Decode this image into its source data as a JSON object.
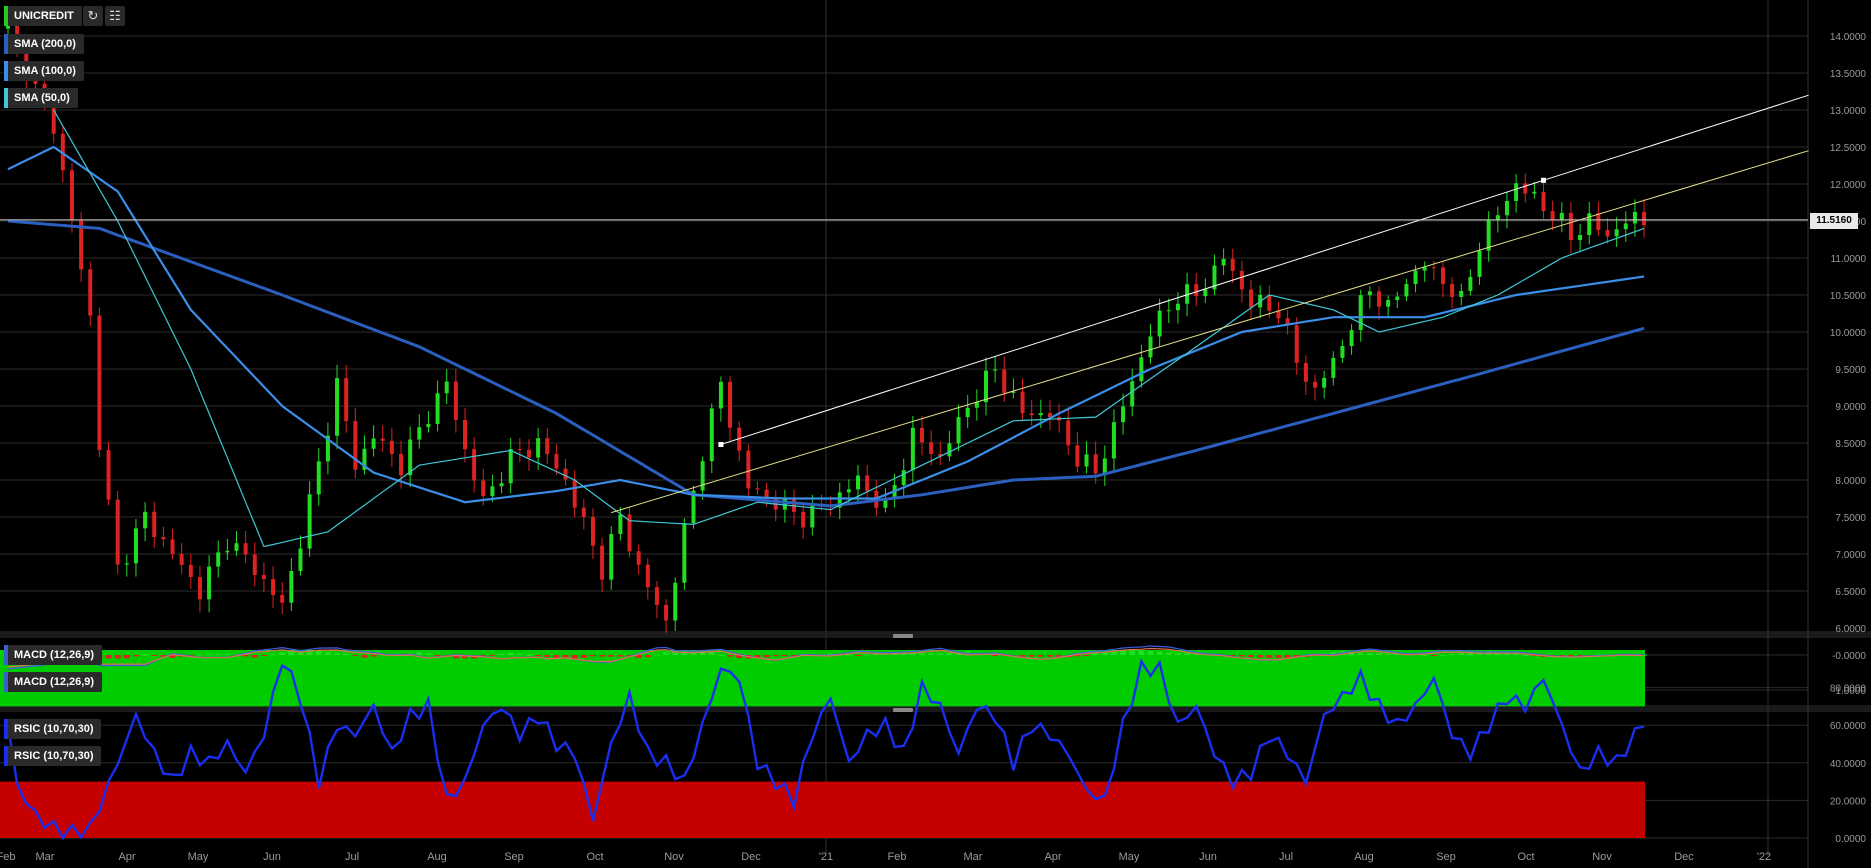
{
  "instrument": "UNICREDIT",
  "toolbar": {
    "refresh_icon": "refresh-icon",
    "chart_settings_icon": "chart-settings-icon"
  },
  "indicators": {
    "sma200": "SMA (200,0)",
    "sma100": "SMA (100,0)",
    "sma50": "SMA (50,0)",
    "macd_a": "MACD (12,26,9)",
    "macd_b": "MACD (12,26,9)",
    "rsic_a": "RSIC (10,70,30)",
    "rsic_b": "RSIC (10,70,30)"
  },
  "last_price": "11.5160",
  "colors": {
    "up": "#22dd22",
    "down": "#dd2222",
    "sma200": "#2a5fc0",
    "sma100": "#3a8ee8",
    "sma50": "#40c8d8",
    "rsi_line": "#1a2ef0",
    "rsi_high_zone": "#00cc00",
    "rsi_low_zone": "#c40000",
    "trend_white": "#ffffff",
    "trend_yellow": "#e6e08a"
  },
  "chart_data": [
    {
      "type": "candlestick",
      "title": "UNICREDIT",
      "x_tick_labels": [
        "Feb",
        "Mar",
        "Apr",
        "May",
        "Jun",
        "Jul",
        "Aug",
        "Sep",
        "Oct",
        "Nov",
        "Dec",
        "'21",
        "Feb",
        "Mar",
        "Apr",
        "May",
        "Jun",
        "Jul",
        "Aug",
        "Sep",
        "Oct",
        "Nov",
        "Dec",
        "'22"
      ],
      "y_tick_labels": [
        "6.0000",
        "6.5000",
        "7.0000",
        "7.5000",
        "8.0000",
        "8.5000",
        "9.0000",
        "9.5000",
        "10.0000",
        "10.5000",
        "11.0000",
        "11.5000",
        "12.0000",
        "12.5000",
        "13.0000",
        "13.5000",
        "14.0000"
      ],
      "ylim": [
        6.0,
        14.2
      ],
      "last_price": 11.516,
      "close_anchors": [
        [
          0,
          14.1
        ],
        [
          4,
          13.0
        ],
        [
          5,
          12.8
        ],
        [
          7,
          11.5
        ],
        [
          9,
          10.2
        ],
        [
          10,
          8.5
        ],
        [
          12,
          6.8
        ],
        [
          15,
          7.5
        ],
        [
          18,
          7.0
        ],
        [
          21,
          6.5
        ],
        [
          24,
          7.2
        ],
        [
          27,
          6.8
        ],
        [
          30,
          6.3
        ],
        [
          32,
          7.2
        ],
        [
          34,
          8.2
        ],
        [
          36,
          9.3
        ],
        [
          38,
          8.2
        ],
        [
          40,
          8.6
        ],
        [
          43,
          8.2
        ],
        [
          46,
          8.9
        ],
        [
          48,
          9.3
        ],
        [
          50,
          8.4
        ],
        [
          52,
          7.7
        ],
        [
          55,
          8.3
        ],
        [
          58,
          8.5
        ],
        [
          61,
          8.0
        ],
        [
          63,
          7.4
        ],
        [
          65,
          6.8
        ],
        [
          67,
          7.5
        ],
        [
          69,
          6.8
        ],
        [
          71,
          6.3
        ],
        [
          72,
          6.1
        ],
        [
          74,
          7.3
        ],
        [
          76,
          8.4
        ],
        [
          78,
          9.3
        ],
        [
          79,
          8.8
        ],
        [
          81,
          7.9
        ],
        [
          84,
          7.7
        ],
        [
          87,
          7.5
        ],
        [
          90,
          7.7
        ],
        [
          93,
          8.0
        ],
        [
          96,
          7.6
        ],
        [
          99,
          8.6
        ],
        [
          102,
          8.3
        ],
        [
          105,
          9.0
        ],
        [
          108,
          9.5
        ],
        [
          111,
          8.9
        ],
        [
          114,
          8.9
        ],
        [
          117,
          8.3
        ],
        [
          119,
          8.1
        ],
        [
          122,
          9.0
        ],
        [
          125,
          10.0
        ],
        [
          128,
          10.5
        ],
        [
          130,
          10.5
        ],
        [
          133,
          11.0
        ],
        [
          136,
          10.4
        ],
        [
          139,
          10.3
        ],
        [
          141,
          9.6
        ],
        [
          143,
          9.2
        ],
        [
          145,
          9.6
        ],
        [
          147,
          10.1
        ],
        [
          149,
          10.6
        ],
        [
          151,
          10.3
        ],
        [
          153,
          10.7
        ],
        [
          155,
          10.9
        ],
        [
          157,
          10.7
        ],
        [
          159,
          10.4
        ],
        [
          161,
          11.2
        ],
        [
          163,
          11.6
        ],
        [
          165,
          12.0
        ],
        [
          167,
          11.8
        ],
        [
          169,
          11.6
        ],
        [
          171,
          11.3
        ],
        [
          173,
          11.5
        ],
        [
          175,
          11.3
        ],
        [
          177,
          11.5
        ],
        [
          179,
          11.52
        ]
      ],
      "sma_anchors": {
        "SMA (200,0)": [
          [
            0,
            11.5
          ],
          [
            10,
            11.4
          ],
          [
            30,
            10.5
          ],
          [
            45,
            9.8
          ],
          [
            60,
            8.9
          ],
          [
            75,
            7.8
          ],
          [
            90,
            7.65
          ],
          [
            100,
            7.8
          ],
          [
            110,
            8.0
          ],
          [
            119,
            8.05
          ],
          [
            130,
            8.4
          ],
          [
            145,
            8.9
          ],
          [
            160,
            9.4
          ],
          [
            179,
            10.05
          ]
        ],
        "SMA (100,0)": [
          [
            0,
            12.2
          ],
          [
            5,
            12.5
          ],
          [
            12,
            11.9
          ],
          [
            20,
            10.3
          ],
          [
            30,
            9.0
          ],
          [
            40,
            8.1
          ],
          [
            50,
            7.7
          ],
          [
            60,
            7.85
          ],
          [
            67,
            8.0
          ],
          [
            75,
            7.8
          ],
          [
            85,
            7.75
          ],
          [
            95,
            7.75
          ],
          [
            105,
            8.25
          ],
          [
            115,
            8.9
          ],
          [
            125,
            9.5
          ],
          [
            135,
            10.0
          ],
          [
            145,
            10.2
          ],
          [
            155,
            10.2
          ],
          [
            165,
            10.5
          ],
          [
            179,
            10.75
          ]
        ],
        "SMA (50,0)": [
          [
            5,
            13.0
          ],
          [
            12,
            11.5
          ],
          [
            20,
            9.5
          ],
          [
            28,
            7.1
          ],
          [
            35,
            7.3
          ],
          [
            45,
            8.2
          ],
          [
            55,
            8.4
          ],
          [
            62,
            8.0
          ],
          [
            68,
            7.45
          ],
          [
            75,
            7.4
          ],
          [
            82,
            7.7
          ],
          [
            90,
            7.6
          ],
          [
            100,
            8.2
          ],
          [
            110,
            8.8
          ],
          [
            119,
            8.85
          ],
          [
            130,
            9.8
          ],
          [
            138,
            10.5
          ],
          [
            145,
            10.3
          ],
          [
            150,
            10.0
          ],
          [
            157,
            10.2
          ],
          [
            163,
            10.5
          ],
          [
            170,
            11.0
          ],
          [
            179,
            11.4
          ]
        ]
      },
      "trendlines": [
        {
          "color": "white",
          "points": [
            [
              78,
              8.48
            ],
            [
              168,
              12.05
            ],
            [
              197,
              13.2
            ]
          ]
        },
        {
          "color": "yellow",
          "points": [
            [
              66,
              7.56
            ],
            [
              197,
              12.45
            ]
          ]
        }
      ],
      "markers": [
        [
          78,
          8.48
        ],
        [
          168,
          12.05
        ]
      ]
    },
    {
      "type": "histogram",
      "title": "MACD (12,26,9)",
      "y_tick_labels": [
        "-0.0000",
        "-1.0000"
      ],
      "ylim": [
        -1.5,
        0.45
      ]
    },
    {
      "type": "line",
      "title": "RSIC (10,70,30)",
      "y_tick_labels": [
        "0.0000",
        "20.0000",
        "40.0000",
        "60.0000",
        "80.0000"
      ],
      "ylim": [
        0,
        100
      ],
      "overbought": 70,
      "oversold": 30,
      "rsi_anchors": [
        [
          0,
          60
        ],
        [
          1,
          28
        ],
        [
          3,
          12
        ],
        [
          6,
          2
        ],
        [
          9,
          5
        ],
        [
          12,
          40
        ],
        [
          14,
          65
        ],
        [
          16,
          45
        ],
        [
          18,
          30
        ],
        [
          20,
          45
        ],
        [
          22,
          40
        ],
        [
          24,
          50
        ],
        [
          26,
          35
        ],
        [
          28,
          55
        ],
        [
          30,
          95
        ],
        [
          32,
          75
        ],
        [
          34,
          30
        ],
        [
          36,
          60
        ],
        [
          38,
          55
        ],
        [
          40,
          70
        ],
        [
          42,
          45
        ],
        [
          44,
          65
        ],
        [
          46,
          70
        ],
        [
          48,
          20
        ],
        [
          50,
          30
        ],
        [
          52,
          60
        ],
        [
          54,
          70
        ],
        [
          56,
          55
        ],
        [
          58,
          65
        ],
        [
          60,
          50
        ],
        [
          62,
          45
        ],
        [
          64,
          10
        ],
        [
          66,
          50
        ],
        [
          68,
          75
        ],
        [
          70,
          45
        ],
        [
          72,
          40
        ],
        [
          74,
          30
        ],
        [
          76,
          60
        ],
        [
          78,
          90
        ],
        [
          80,
          85
        ],
        [
          82,
          40
        ],
        [
          84,
          30
        ],
        [
          86,
          20
        ],
        [
          88,
          55
        ],
        [
          90,
          75
        ],
        [
          92,
          40
        ],
        [
          94,
          55
        ],
        [
          96,
          60
        ],
        [
          98,
          45
        ],
        [
          100,
          80
        ],
        [
          102,
          70
        ],
        [
          104,
          45
        ],
        [
          106,
          70
        ],
        [
          108,
          65
        ],
        [
          110,
          40
        ],
        [
          112,
          60
        ],
        [
          114,
          55
        ],
        [
          116,
          45
        ],
        [
          118,
          25
        ],
        [
          120,
          20
        ],
        [
          122,
          60
        ],
        [
          124,
          90
        ],
        [
          126,
          90
        ],
        [
          128,
          60
        ],
        [
          130,
          70
        ],
        [
          132,
          45
        ],
        [
          134,
          30
        ],
        [
          136,
          35
        ],
        [
          138,
          55
        ],
        [
          140,
          45
        ],
        [
          142,
          30
        ],
        [
          144,
          65
        ],
        [
          146,
          75
        ],
        [
          148,
          85
        ],
        [
          150,
          70
        ],
        [
          152,
          60
        ],
        [
          154,
          70
        ],
        [
          156,
          85
        ],
        [
          158,
          55
        ],
        [
          160,
          45
        ],
        [
          162,
          60
        ],
        [
          164,
          75
        ],
        [
          166,
          70
        ],
        [
          168,
          85
        ],
        [
          170,
          60
        ],
        [
          172,
          35
        ],
        [
          174,
          45
        ],
        [
          176,
          40
        ],
        [
          178,
          55
        ],
        [
          179,
          62
        ]
      ]
    }
  ]
}
